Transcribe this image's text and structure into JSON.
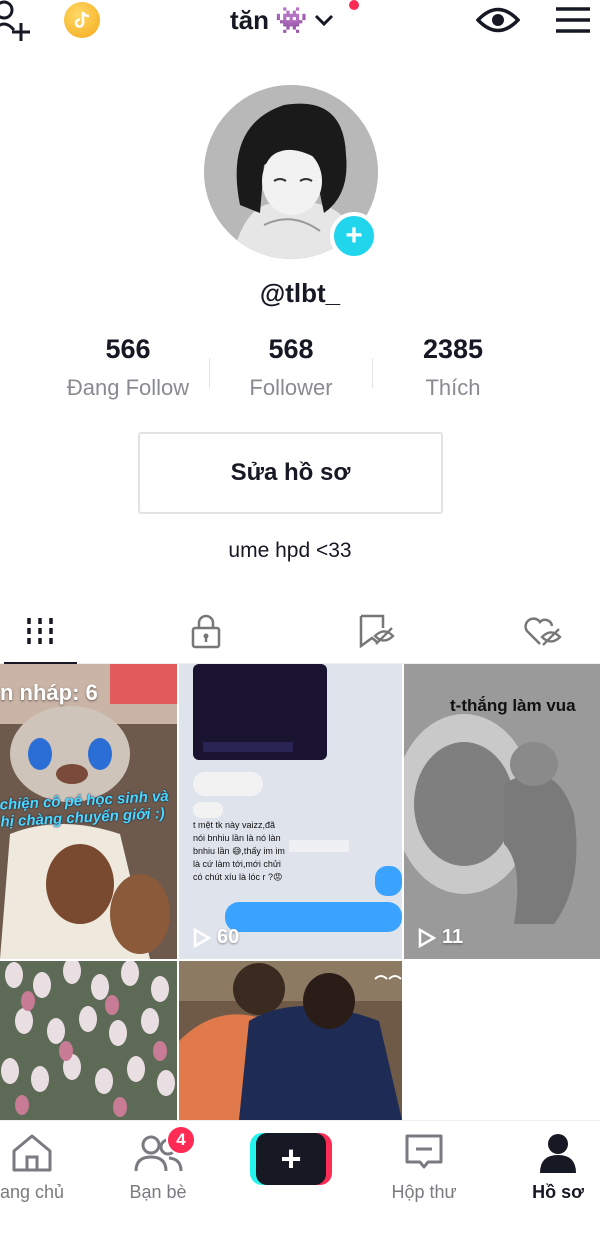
{
  "header": {
    "title": "tăn",
    "title_emoji": "👾",
    "icons": [
      "add-user-icon",
      "coin-icon",
      "chevron-down-icon",
      "eye-icon",
      "menu-icon"
    ],
    "notification_dot_color": "#fe2c55"
  },
  "profile": {
    "username": "@tlbt_",
    "add_icon": "+",
    "stats": [
      {
        "value": "566",
        "label": "Đang Follow"
      },
      {
        "value": "568",
        "label": "Follower"
      },
      {
        "value": "2385",
        "label": "Thích"
      }
    ],
    "edit_label": "Sửa hồ sơ",
    "bio": "ume hpd <33"
  },
  "tabs": [
    {
      "name": "videos",
      "icon": "grid-icon",
      "active": true
    },
    {
      "name": "private",
      "icon": "lock-icon",
      "active": false
    },
    {
      "name": "saved",
      "icon": "bookmark-hidden-icon",
      "active": false
    },
    {
      "name": "liked",
      "icon": "heart-hidden-icon",
      "active": false
    }
  ],
  "videos": [
    {
      "draft_label": "n nháp: 6",
      "caption": "chiện cô pé học sinh và\nhị chàng chuyển giới :)"
    },
    {
      "views": "60",
      "text": "t mệt tk này vaizz,đã\nnói bnhiu lần là nó làn\nbnhiu lần 😅,thấy im im\nlà cứ làm tới,mới chửi\ncó chút xíu là lóc r ?😡"
    },
    {
      "views": "11",
      "title": "t-thắng làm vua"
    },
    {},
    {},
    {}
  ],
  "bottom_nav": {
    "items": [
      {
        "label": "ang chủ",
        "icon": "home-icon"
      },
      {
        "label": "Bạn bè",
        "icon": "friends-icon",
        "badge": "4"
      },
      {
        "label": "+",
        "icon": "create-icon"
      },
      {
        "label": "Hộp thư",
        "icon": "inbox-icon"
      },
      {
        "label": "Hồ sơ",
        "icon": "profile-icon",
        "active": true
      }
    ]
  },
  "colors": {
    "accent": "#fe2c55",
    "cyan": "#25f4ee",
    "add_button": "#20d5ec",
    "text": "#161823",
    "muted": "#8a8b91"
  }
}
